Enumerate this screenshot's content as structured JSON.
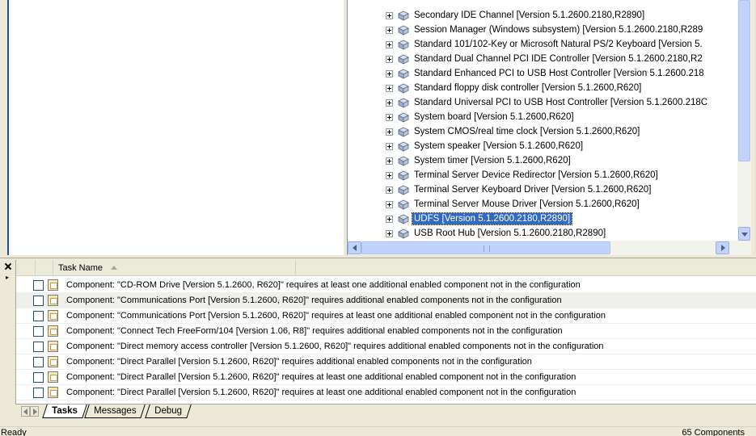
{
  "tree": {
    "items": [
      {
        "label": "Secondary IDE Channel [Version 5.1.2600.2180,R2890]",
        "selected": false
      },
      {
        "label": "Session Manager (Windows subsystem) [Version 5.1.2600.2180,R289",
        "selected": false
      },
      {
        "label": "Standard 101/102-Key or Microsoft Natural PS/2 Keyboard [Version 5.",
        "selected": false
      },
      {
        "label": "Standard Dual Channel PCI IDE Controller [Version 5.1.2600.2180,R2",
        "selected": false
      },
      {
        "label": "Standard Enhanced PCI to USB Host Controller [Version 5.1.2600.218",
        "selected": false
      },
      {
        "label": "Standard floppy disk controller [Version 5.1.2600,R620]",
        "selected": false
      },
      {
        "label": "Standard Universal PCI to USB Host Controller [Version 5.1.2600.218C",
        "selected": false
      },
      {
        "label": "System board [Version 5.1.2600,R620]",
        "selected": false
      },
      {
        "label": "System CMOS/real time clock [Version 5.1.2600,R620]",
        "selected": false
      },
      {
        "label": "System speaker [Version 5.1.2600,R620]",
        "selected": false
      },
      {
        "label": "System timer [Version 5.1.2600,R620]",
        "selected": false
      },
      {
        "label": "Terminal Server Device Redirector [Version 5.1.2600,R620]",
        "selected": false
      },
      {
        "label": "Terminal Server Keyboard Driver [Version 5.1.2600,R620]",
        "selected": false
      },
      {
        "label": "Terminal Server Mouse Driver [Version 5.1.2600,R620]",
        "selected": false
      },
      {
        "label": "UDFS [Version 5.1.2600.2180,R2890]",
        "selected": true
      },
      {
        "label": "USB Root Hub [Version 5.1.2600.2180,R2890]",
        "selected": false
      }
    ]
  },
  "scrollbar": {
    "vertical_position_fraction": 0.0,
    "horizontal_position_fraction": 0.0
  },
  "tasks": {
    "column_header": "Task Name",
    "rows": [
      {
        "text": "Component: \"CD-ROM Drive [Version 5.1.2600, R620]\" requires at least one additional enabled component not in the configuration",
        "checked": false
      },
      {
        "text": "Component: \"Communications Port [Version 5.1.2600, R620]\" requires additional enabled components not in the configuration",
        "checked": false
      },
      {
        "text": "Component: \"Communications Port [Version 5.1.2600, R620]\" requires at least one additional enabled component not in the configuration",
        "checked": false
      },
      {
        "text": "Component: \"Connect Tech FreeForm/104 [Version 1.06, R8]\" requires additional enabled components not in the configuration",
        "checked": false
      },
      {
        "text": "Component: \"Direct memory access controller [Version 5.1.2600, R620]\" requires additional enabled components not in the configuration",
        "checked": false
      },
      {
        "text": "Component: \"Direct Parallel [Version 5.1.2600, R620]\" requires additional enabled components not in the configuration",
        "checked": false
      },
      {
        "text": "Component: \"Direct Parallel [Version 5.1.2600, R620]\" requires at least one additional enabled component not in the configuration",
        "checked": false
      },
      {
        "text": "Component: \"Direct Parallel [Version 5.1.2600, R620]\" requires at least one additional enabled component not in the configuration",
        "checked": false
      }
    ]
  },
  "tabs": [
    {
      "label": "Tasks",
      "active": true
    },
    {
      "label": "Messages",
      "active": false
    },
    {
      "label": "Debug",
      "active": false
    }
  ],
  "status": {
    "left": "Ready",
    "right": "65 Components"
  },
  "icons": {
    "tree_expander": "plus-box-icon",
    "component": "component-icon",
    "task": "task-icon",
    "panel_close": "close-icon",
    "panel_pin": "pin-icon"
  },
  "colors": {
    "selection": "#316ac5",
    "scrollbar": "#c1d3fb",
    "chrome": "#ece9d8"
  }
}
